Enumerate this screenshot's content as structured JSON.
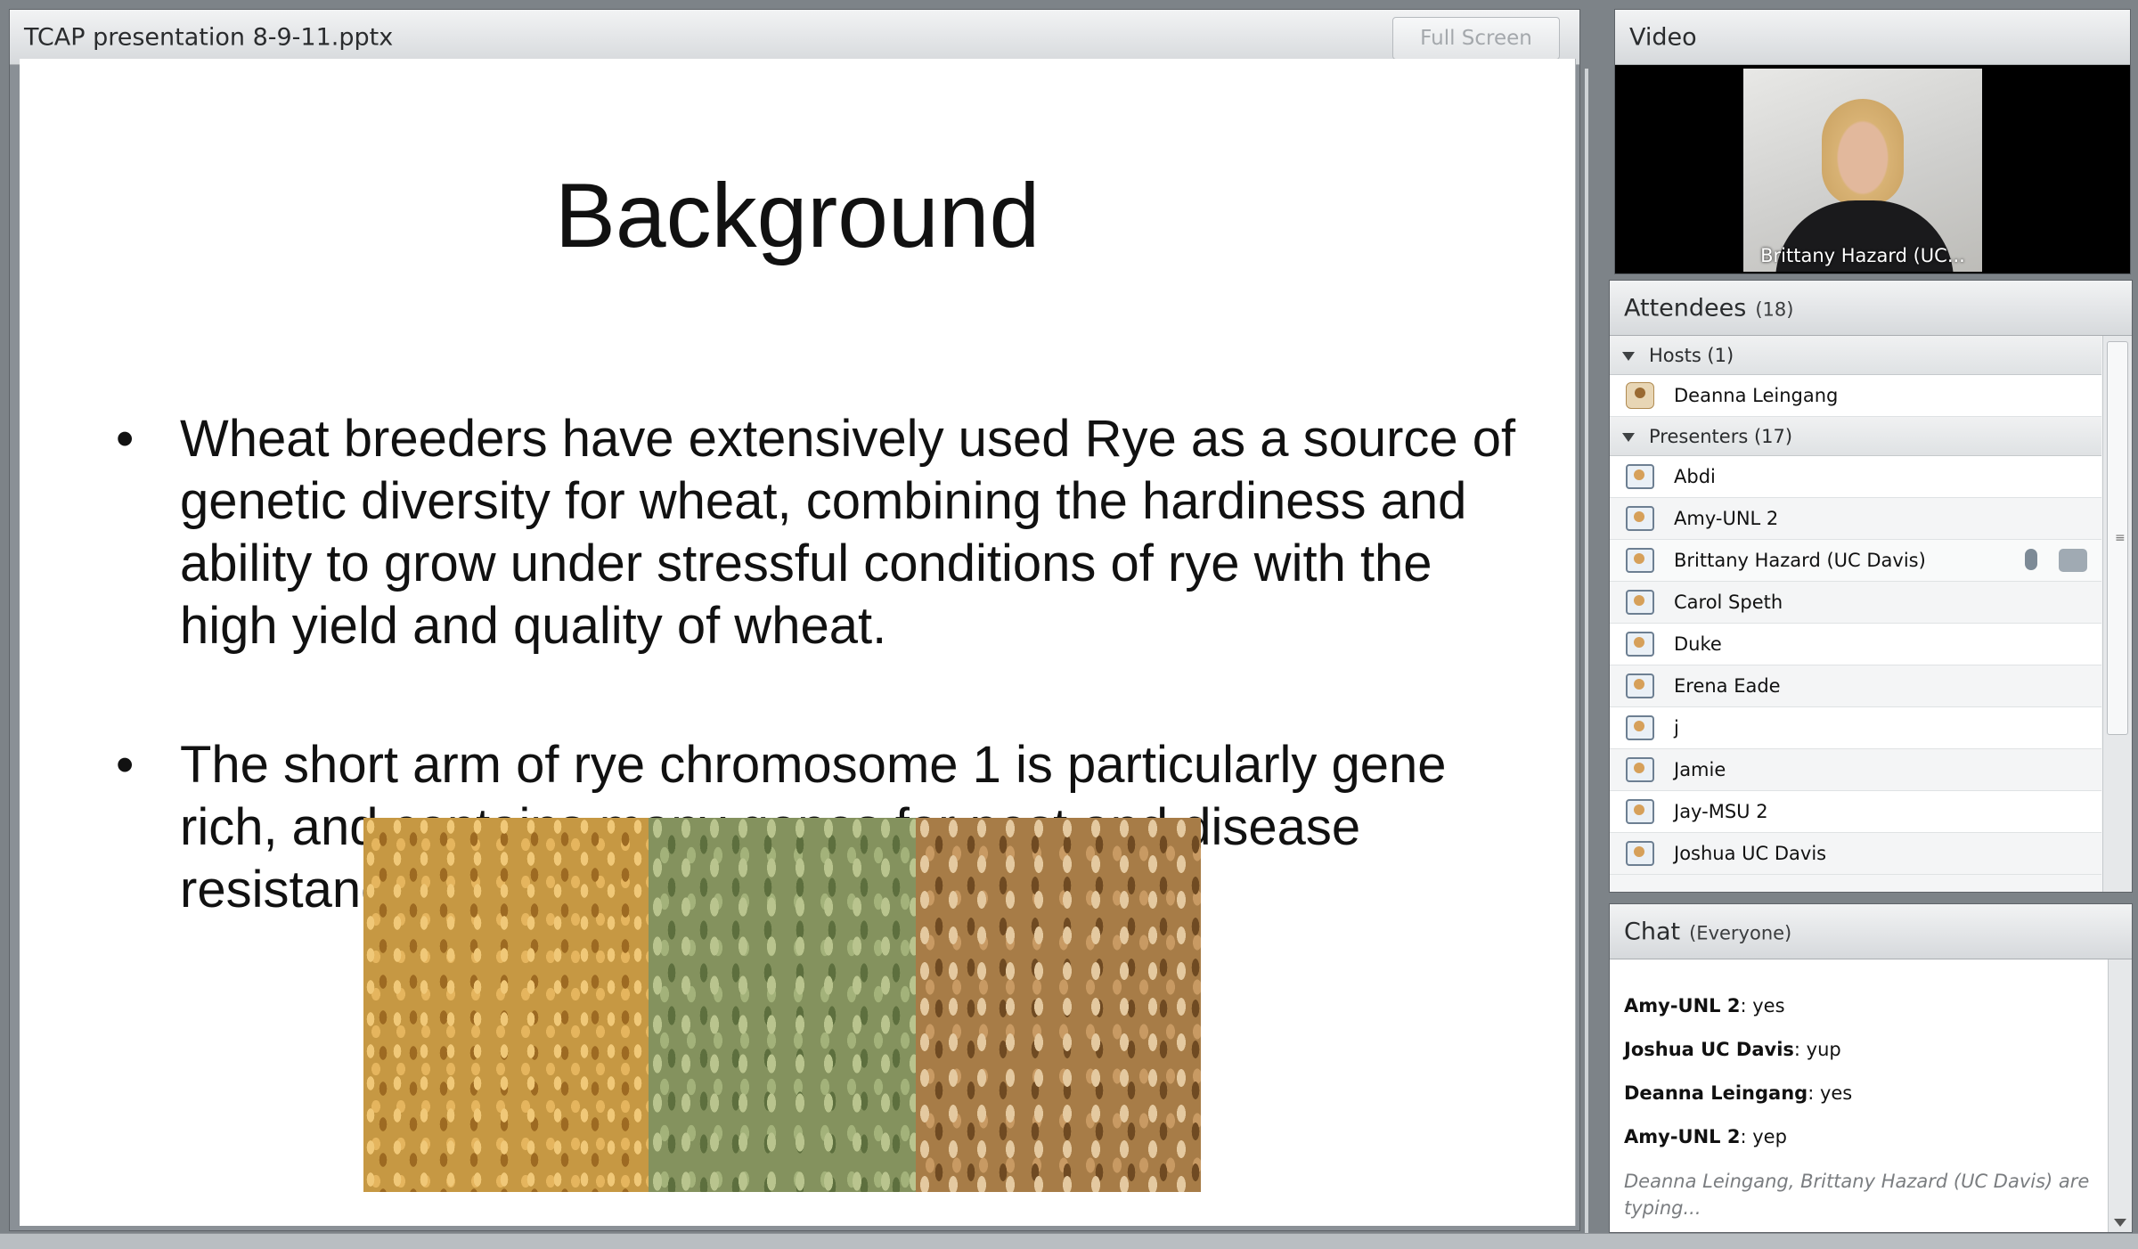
{
  "presentation": {
    "file_title": "TCAP presentation 8-9-11.pptx",
    "fullscreen_label": "Full Screen",
    "slide": {
      "title": "Background",
      "bullets": [
        "Wheat breeders have extensively used Rye as a source of genetic diversity for wheat, combining the hardiness and ability to grow under stressful conditions of rye with the high yield and quality of wheat.",
        "The short arm of rye chromosome 1 is particularly gene rich, and contains many genes for pest and disease resistance."
      ]
    }
  },
  "video": {
    "title": "Video",
    "speaker_name": "Brittany Hazard (UC..."
  },
  "attendees": {
    "title": "Attendees",
    "count": "(18)",
    "hosts_group": "Hosts (1)",
    "hosts": [
      "Deanna Leingang"
    ],
    "presenters_group": "Presenters (17)",
    "presenters": [
      "Abdi",
      "Amy-UNL 2",
      "Brittany Hazard (UC Davis)",
      "Carol Speth",
      "Duke",
      "Erena Eade",
      "j",
      "Jamie",
      "Jay-MSU 2",
      "Joshua UC Davis"
    ]
  },
  "chat": {
    "title": "Chat",
    "scope": "(Everyone)",
    "messages": [
      {
        "sender": "Amy-UNL 2",
        "text": "yes"
      },
      {
        "sender": "Joshua UC Davis",
        "text": "yup"
      },
      {
        "sender": "Deanna Leingang",
        "text": "yes"
      },
      {
        "sender": "Amy-UNL 2",
        "text": "yep"
      }
    ],
    "typing_status": "Deanna Leingang, Brittany Hazard (UC Davis) are typing..."
  }
}
